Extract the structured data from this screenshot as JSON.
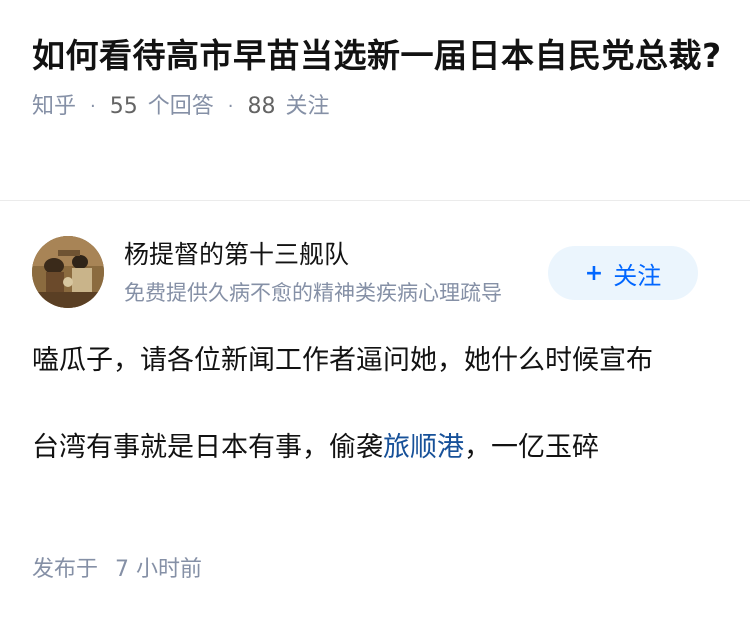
{
  "question": {
    "title": "如何看待高市早苗当选新一届日本自民党总裁?",
    "source": "知乎",
    "answer_count": "55",
    "answer_label": "个回答",
    "follower_count": "88",
    "follower_label": "关注"
  },
  "author": {
    "name": "杨提督的第十三舰队",
    "bio": "免费提供久病不愈的精神类疾病心理疏导",
    "follow_plus": "+",
    "follow_label": "关注",
    "avatar_icon": "painting-avatar"
  },
  "answer": {
    "paragraph_1": "嗑瓜子，请各位新闻工作者逼问她，她什么时候宣布",
    "paragraph_2_before": "台湾有事就是日本有事，偷袭",
    "paragraph_2_link": "旅顺港",
    "paragraph_2_after": "，一亿玉碎"
  },
  "footer": {
    "published_label": "发布于",
    "published_time": "7 小时前"
  },
  "colors": {
    "text": "#121212",
    "meta": "#8590a6",
    "link": "#175199",
    "follow_bg": "#ebf5fd",
    "follow_text": "#0066ff",
    "divider": "#ebebeb"
  }
}
